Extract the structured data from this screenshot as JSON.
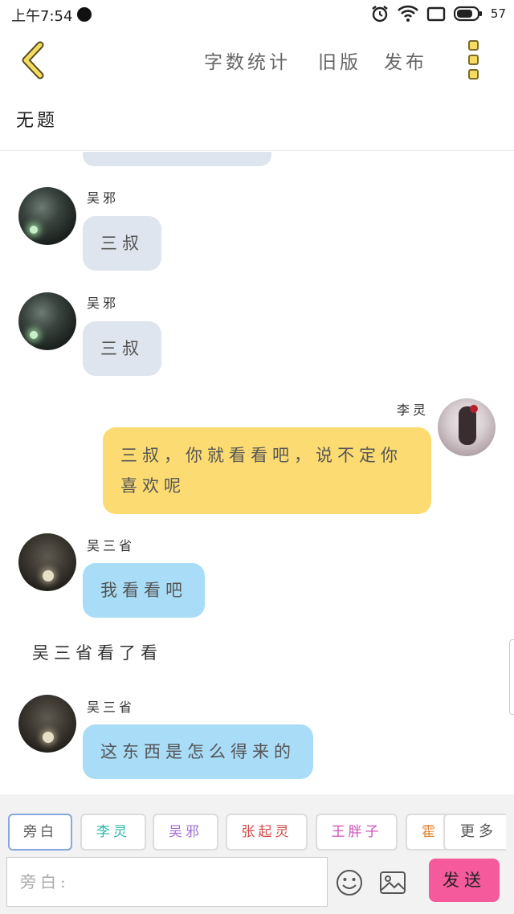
{
  "status_bar": {
    "time": "上午7:54",
    "battery": "57"
  },
  "header": {
    "nav": [
      "字数统计",
      "旧版",
      "发布"
    ],
    "title": "无题"
  },
  "messages": [
    {
      "name": "吴邪",
      "text": "三叔"
    },
    {
      "name": "吴邪",
      "text": "三叔"
    },
    {
      "name": "李灵",
      "text": "三叔，你就看看吧，说不定你喜欢呢"
    },
    {
      "name": "吴三省",
      "text": "我看看吧"
    },
    {
      "narration": "吴三省看了看"
    },
    {
      "name": "吴三省",
      "text": "这东西是怎么得来的"
    }
  ],
  "composer": {
    "chips": [
      {
        "label": "旁白",
        "color": "#555555"
      },
      {
        "label": "李灵",
        "color": "#2fb6a6"
      },
      {
        "label": "吴邪",
        "color": "#a070d8"
      },
      {
        "label": "张起灵",
        "color": "#d04a4a"
      },
      {
        "label": "王胖子",
        "color": "#d050b8"
      },
      {
        "label": "霍",
        "color": "#e08a3a"
      }
    ],
    "more_label": "更多",
    "input_placeholder": "旁白:",
    "send_label": "发送"
  },
  "colors": {
    "accent_yellow": "#fcdc72",
    "bubble_gray": "#dfe5ee",
    "bubble_blue": "#a9dcf7",
    "send_pink": "#f45a9c"
  }
}
